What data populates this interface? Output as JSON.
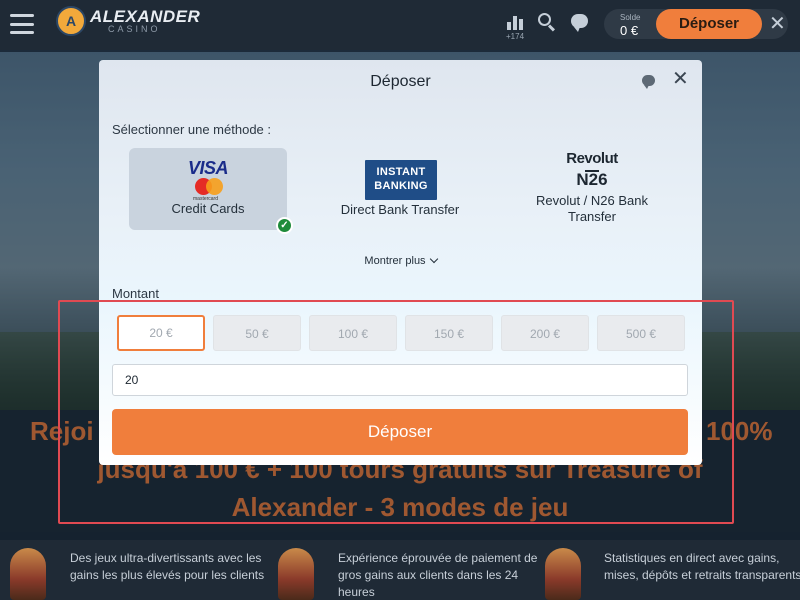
{
  "header": {
    "logo_main": "ALEXANDER",
    "logo_sub": "CASINO",
    "stats_count": "+174",
    "balance_label": "Solde",
    "balance_value": "0 €",
    "deposit_label": "Déposer"
  },
  "promo": {
    "line1": "Rejoi...100%",
    "line1_left": "Rejoi",
    "line1_right": "100%",
    "line2": "jusqu'à 100 € + 100 tours gratuits sur Treasure of",
    "line3": "Alexander - 3 modes de jeu"
  },
  "features": [
    {
      "text": "Des jeux ultra-divertissants avec les gains les plus élevés pour les clients"
    },
    {
      "text": "Expérience éprouvée de paiement de gros gains aux clients dans les 24 heures"
    },
    {
      "text": "Statistiques en direct avec gains, mises, dépôts et retraits transparents"
    }
  ],
  "modal": {
    "title": "Déposer",
    "method_label": "Sélectionner une méthode :",
    "methods": [
      {
        "name": "Credit Cards",
        "logo": "VISA",
        "logo_sub": "mastercard",
        "selected": true
      },
      {
        "name": "Direct Bank Transfer",
        "logo_line1": "INSTANT",
        "logo_line2": "BANKING",
        "selected": false
      },
      {
        "name": "Revolut / N26 Bank Transfer",
        "logo_line1": "Revolut",
        "logo_line2": "N26",
        "selected": false
      }
    ],
    "show_more": "Montrer plus",
    "amount_label": "Montant",
    "amounts": [
      "20 €",
      "50 €",
      "100 €",
      "150 €",
      "200 €",
      "500 €"
    ],
    "selected_amount_index": 0,
    "amount_value": "20",
    "submit_label": "Déposer"
  },
  "colors": {
    "accent": "#f07e3c",
    "brand_dark": "#1f2a36",
    "selected_check": "#1e8b3a",
    "highlight": "#e04a52"
  }
}
